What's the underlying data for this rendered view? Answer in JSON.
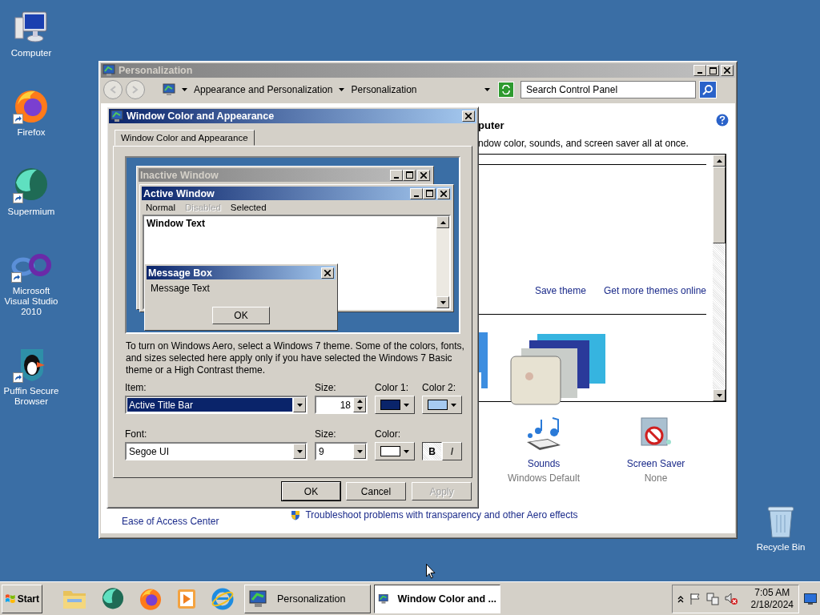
{
  "desktop_icons": [
    {
      "label": "Computer",
      "kind": "computer",
      "shortcut": false
    },
    {
      "label": "Firefox",
      "kind": "firefox",
      "shortcut": true
    },
    {
      "label": "Supermium",
      "kind": "supermium",
      "shortcut": true
    },
    {
      "label": "Microsoft Visual Studio 2010",
      "kind": "vs",
      "shortcut": true
    },
    {
      "label": "Puffin Secure Browser",
      "kind": "puffin",
      "shortcut": true
    },
    {
      "label": "Recycle Bin",
      "kind": "recycle",
      "shortcut": false
    }
  ],
  "personalization_window": {
    "title": "Personalization",
    "active": false,
    "breadcrumbs": [
      "Appearance and Personalization",
      "Personalization"
    ],
    "search": {
      "placeholder": "Search Control Panel"
    },
    "heading": "puter",
    "description": "ndow color, sounds, and screen saver all at once.",
    "theme_links": [
      "Save theme",
      "Get more themes online"
    ],
    "settings": [
      {
        "label": "Sounds",
        "value": "Windows Default",
        "kind": "sounds"
      },
      {
        "label": "Screen Saver",
        "value": "None",
        "kind": "screensaver"
      }
    ],
    "see_also": [
      "Ease of Access Center"
    ],
    "troubleshoot_link": "Troubleshoot problems with transparency and other Aero effects"
  },
  "dialog": {
    "title": "Window Color and Appearance",
    "active": true,
    "tabs": [
      {
        "label": "Window Color and Appearance",
        "selected": true
      }
    ],
    "preview": {
      "inactive_title": "Inactive Window",
      "active_title": "Active Window",
      "menu": [
        {
          "label": "Normal",
          "disabled": false
        },
        {
          "label": "Disabled",
          "disabled": true
        },
        {
          "label": "Selected",
          "disabled": false
        }
      ],
      "window_text": "Window Text",
      "message_title": "Message Box",
      "message_text": "Message Text",
      "message_button": "OK"
    },
    "note": "To turn on Windows Aero, select a Windows 7 theme.  Some of the colors, fonts, and sizes selected here apply only if you have selected the Windows 7 Basic theme or a High Contrast theme.",
    "item": {
      "label": "Item:",
      "value": "Active Title Bar"
    },
    "item_size": {
      "label": "Size:",
      "value": "18"
    },
    "color1": {
      "label": "Color 1:",
      "color": "#0a246a"
    },
    "color2": {
      "label": "Color 2:",
      "color": "#a6caf0"
    },
    "font": {
      "label": "Font:",
      "value": "Segoe UI"
    },
    "font_size": {
      "label": "Size:",
      "value": "9"
    },
    "font_color": {
      "label": "Color:",
      "color": "#ffffff"
    },
    "bold": {
      "label": "B",
      "on": true
    },
    "italic": {
      "label": "I",
      "on": false
    },
    "buttons": [
      {
        "label": "OK",
        "kind": "default",
        "disabled": false
      },
      {
        "label": "Cancel",
        "kind": "normal",
        "disabled": false
      },
      {
        "label": "Apply",
        "kind": "normal",
        "disabled": true
      }
    ]
  },
  "taskbar": {
    "start": "Start",
    "quick_launch": [
      {
        "kind": "folder"
      },
      {
        "kind": "supermium"
      },
      {
        "kind": "firefox"
      },
      {
        "kind": "media"
      },
      {
        "kind": "ie"
      }
    ],
    "tasks": [
      {
        "label": "Personalization",
        "selected": false
      },
      {
        "label": "Window Color and ...",
        "selected": true
      }
    ],
    "tray": {
      "time": "7:05 AM",
      "date": "2/18/2024"
    }
  }
}
